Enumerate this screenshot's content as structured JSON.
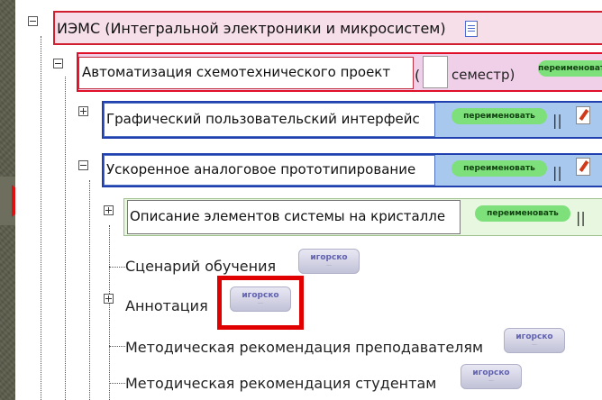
{
  "tree": {
    "root": {
      "label": "ИЭМС (Интегральной электроники и микросистем)"
    },
    "course": {
      "name": "Автоматизация схемотехнического проект",
      "paren_open": "(",
      "semester_value": "",
      "semester_label": "семестр)",
      "rename_label": "переименовать"
    },
    "module1": {
      "name": "Графический пользовательский интерфейс",
      "rename_label": "переименовать",
      "separator": "||"
    },
    "module2": {
      "name": "Ускоренное аналоговое прототипирование",
      "rename_label": "переименовать",
      "separator": "||"
    },
    "submodule": {
      "name": "Описание элементов системы на кристалле",
      "rename_label": "переименовать",
      "separator": "||"
    },
    "items": [
      {
        "label": "Сценарий обучения",
        "badge_top": "игорско",
        "badge_bottom": "···"
      },
      {
        "label": "Аннотация",
        "badge_top": "игорско",
        "badge_bottom": "···"
      },
      {
        "label": "Методическая рекомендация преподавателям",
        "badge_top": "игорско",
        "badge_bottom": "···"
      },
      {
        "label": "Методическая рекомендация студентам",
        "badge_top": "игорско",
        "badge_bottom": "···"
      }
    ]
  },
  "colors": {
    "highlight": "#e00000",
    "root_bg": "#f7dfea",
    "root_border": "#d02030",
    "course_bg": "#f0d0e8",
    "course_border": "#e0102a",
    "module_bg": "#a8c8ee",
    "module_border": "#2040b0",
    "rename_green": "#7de07a",
    "submodule_bg": "#e8f8e0"
  }
}
